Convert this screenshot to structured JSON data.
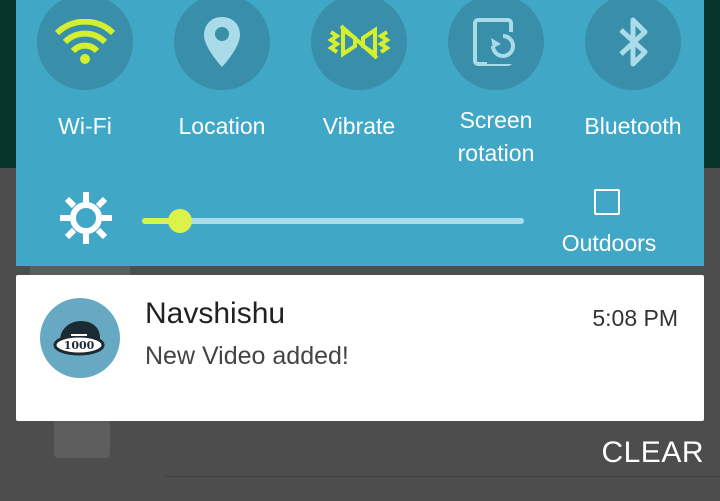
{
  "quick_settings": {
    "tiles": [
      {
        "id": "wifi",
        "label": "Wi-Fi",
        "icon": "wifi-icon",
        "active": true
      },
      {
        "id": "location",
        "label": "Location",
        "icon": "location-icon",
        "active": false
      },
      {
        "id": "vibrate",
        "label": "Vibrate",
        "icon": "vibrate-icon",
        "active": true
      },
      {
        "id": "rotation",
        "label": "Screen\nrotation",
        "icon": "screen-rotation-icon",
        "active": false
      },
      {
        "id": "bluetooth",
        "label": "Bluetooth",
        "icon": "bluetooth-icon",
        "active": false
      }
    ],
    "brightness": {
      "level": 0.1,
      "icon": "brightness-icon"
    },
    "outdoors": {
      "label": "Outdoors",
      "checked": false
    }
  },
  "notification": {
    "app": "Navshishu",
    "time": "5:08 PM",
    "message": "New Video added!",
    "icon": "navshishu-logo"
  },
  "clear_label": "CLEAR",
  "colors": {
    "panel": "#41a7c6",
    "tile_circle": "#398ea9",
    "active_icon": "#d4ef2f",
    "inactive_icon": "#a9dbe9"
  }
}
